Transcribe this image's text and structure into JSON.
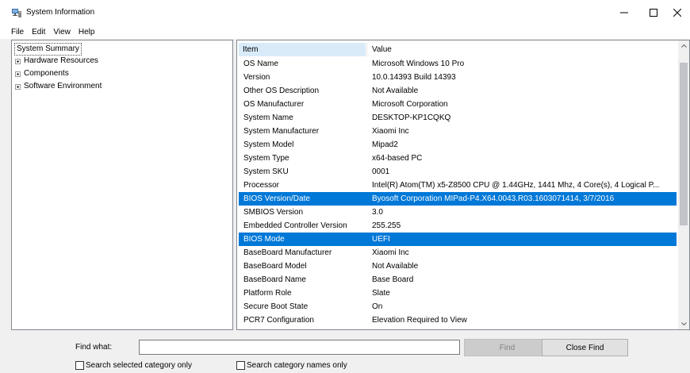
{
  "window": {
    "title": "System Information",
    "icon": "system-information-icon",
    "controls": [
      "minimize-icon",
      "maximize-icon",
      "close-icon"
    ]
  },
  "menu": [
    "File",
    "Edit",
    "View",
    "Help"
  ],
  "tree": {
    "root": "System Summary",
    "items": [
      "Hardware Resources",
      "Components",
      "Software Environment"
    ]
  },
  "details": {
    "columns": {
      "item": "Item",
      "value": "Value"
    },
    "rows": [
      {
        "item": "OS Name",
        "value": "Microsoft Windows 10 Pro"
      },
      {
        "item": "Version",
        "value": "10.0.14393 Build 14393"
      },
      {
        "item": "Other OS Description",
        "value": "Not Available"
      },
      {
        "item": "OS Manufacturer",
        "value": "Microsoft Corporation"
      },
      {
        "item": "System Name",
        "value": "DESKTOP-KP1CQKQ"
      },
      {
        "item": "System Manufacturer",
        "value": "Xiaomi Inc"
      },
      {
        "item": "System Model",
        "value": "Mipad2"
      },
      {
        "item": "System Type",
        "value": "x64-based PC"
      },
      {
        "item": "System SKU",
        "value": "0001"
      },
      {
        "item": "Processor",
        "value": "Intel(R) Atom(TM) x5-Z8500  CPU @ 1.44GHz, 1441 Mhz, 4 Core(s), 4 Logical P..."
      },
      {
        "item": "BIOS Version/Date",
        "value": "Byosoft Corporation MIPad-P4.X64.0043.R03.1603071414, 3/7/2016",
        "selected": true
      },
      {
        "item": "SMBIOS Version",
        "value": "3.0"
      },
      {
        "item": "Embedded Controller Version",
        "value": "255.255"
      },
      {
        "item": "BIOS Mode",
        "value": "UEFI",
        "selected": true
      },
      {
        "item": "BaseBoard Manufacturer",
        "value": "Xiaomi Inc"
      },
      {
        "item": "BaseBoard Model",
        "value": "Not Available"
      },
      {
        "item": "BaseBoard Name",
        "value": "Base Board"
      },
      {
        "item": "Platform Role",
        "value": "Slate"
      },
      {
        "item": "Secure Boot State",
        "value": "On"
      },
      {
        "item": "PCR7 Configuration",
        "value": "Elevation Required to View"
      }
    ]
  },
  "find": {
    "label": "Find what:",
    "value": "",
    "find_button": "Find",
    "close_button": "Close Find",
    "option_selected": "Search selected category only",
    "option_names": "Search category names only"
  },
  "colors": {
    "selection": "#0078d7",
    "header_highlight": "#d9ebf9",
    "window_background": "#f0f0f0"
  }
}
